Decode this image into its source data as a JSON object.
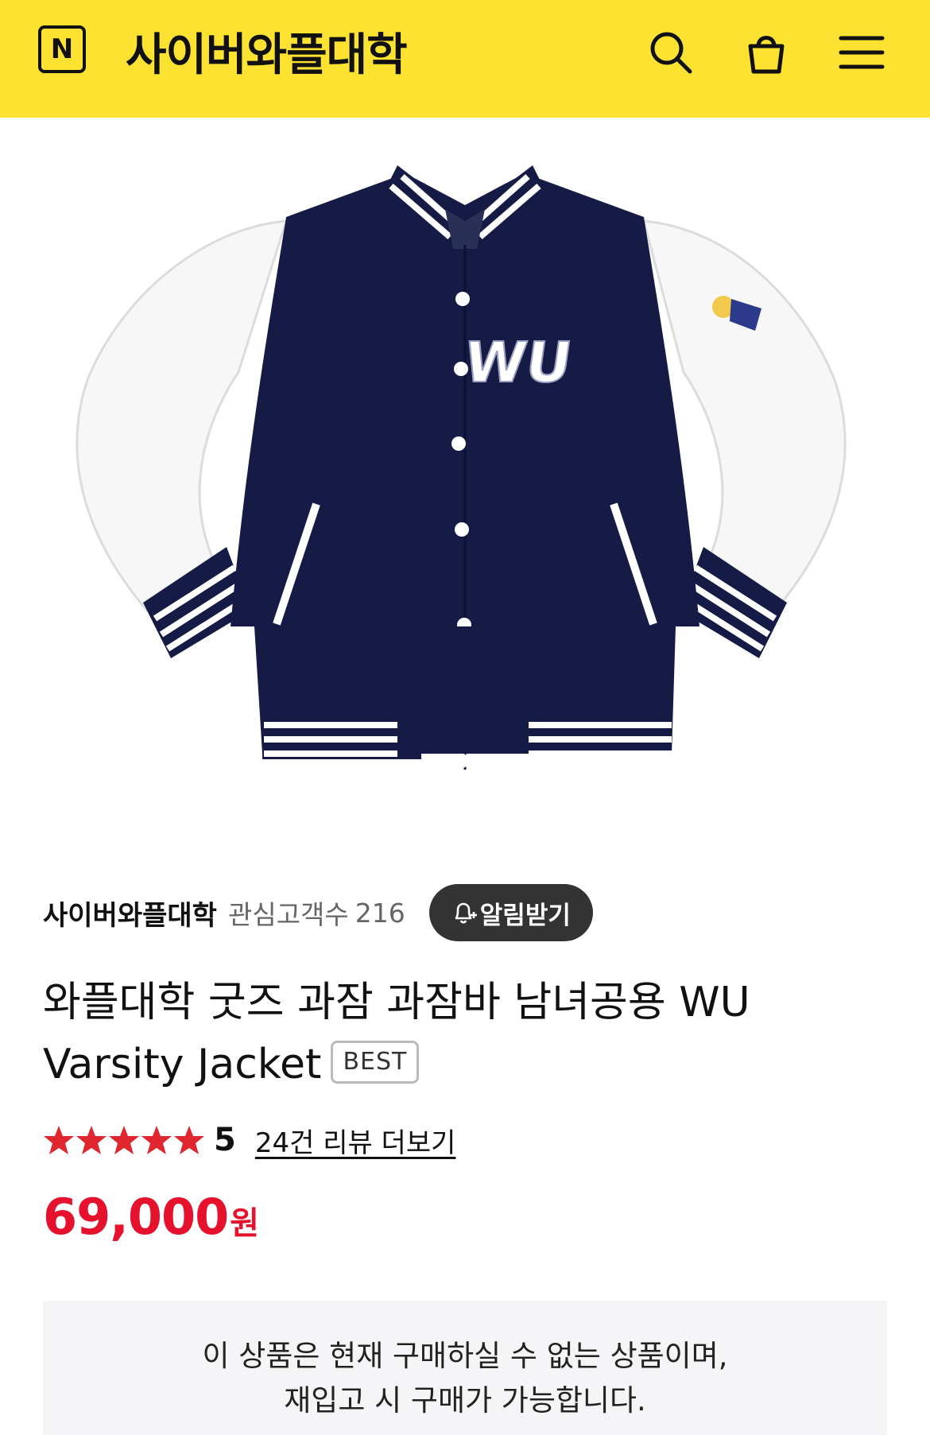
{
  "header": {
    "logo_letter": "N",
    "store_title": "사이버와플대학",
    "icons": [
      "search-icon",
      "shopping-bag-icon",
      "menu-icon"
    ],
    "background_color": "#fde232"
  },
  "product_image": {
    "logo_text": "WU",
    "jacket_body_color": "#151b45",
    "sleeve_color": "#ffffff"
  },
  "store": {
    "name": "사이버와플대학",
    "interest_label": "관심고객수",
    "interest_count": "216",
    "alert_button": "알림받기"
  },
  "product": {
    "title": "와플대학 굿즈 과잠 과잠바 남녀공용 WU Varsity Jacket",
    "badge": "BEST",
    "rating_value": "5",
    "stars_filled": 5,
    "review_link": "24건 리뷰 더보기",
    "price": "69,000",
    "currency": "원",
    "price_color": "#e5112d"
  },
  "notice": {
    "line1": "이 상품은 현재 구매하실 수 없는 상품이며,",
    "line2": "재입고 시 구매가 가능합니다."
  }
}
